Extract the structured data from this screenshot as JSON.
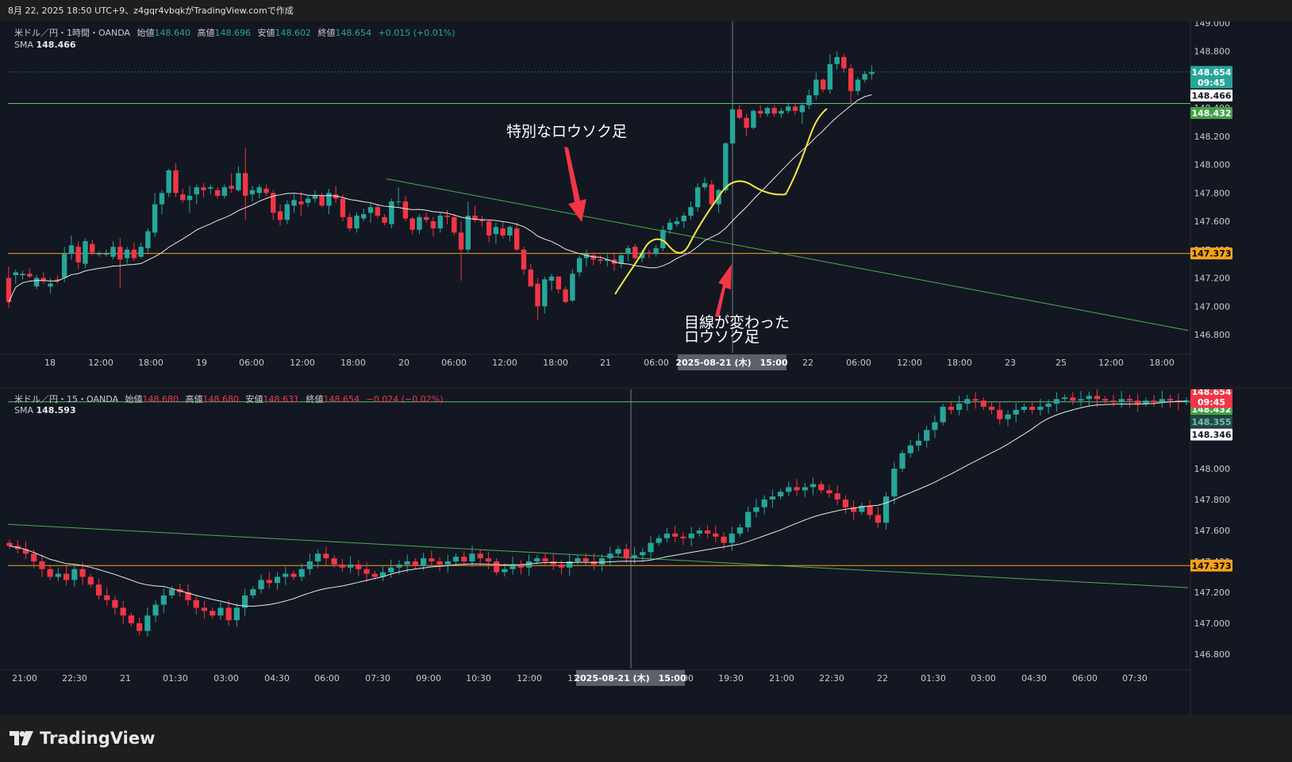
{
  "header": {
    "text": "8月 22, 2025 18:50 UTC+9、z4gqr4vbqkがTradingView.comで作成"
  },
  "brand": {
    "name": "TradingView"
  },
  "colors": {
    "background": "#131722",
    "up": "#26a69a",
    "down": "#f23645",
    "sma": "#e8e8e8",
    "level_orange": "#f7a21b",
    "level_green": "#66bb6a",
    "trendline": "#4caf50",
    "hand_drawn": "#f5e642",
    "arrow": "#f23645"
  },
  "chart1": {
    "legend": {
      "symbol": "米ドル／円・1時間・OANDA",
      "open_label": "始値",
      "open": "148.640",
      "high_label": "高値",
      "high": "148.696",
      "low_label": "安値",
      "low": "148.602",
      "close_label": "終値",
      "close": "148.654",
      "change": "+0.015 (+0.01%)",
      "sma_label": "SMA",
      "sma_value": "148.466"
    },
    "annotations": {
      "special_candle": "特別なロウソク足",
      "view_change_line1": "目線が変わった",
      "view_change_line2": "ロウソク足"
    },
    "crosshair_time": "2025-08-21 (木)　15:00",
    "badges": {
      "last_price": "148.654",
      "countdown": "09:45",
      "sma": "148.466",
      "green_level": "148.432",
      "orange_level": "147.373"
    }
  },
  "chart2": {
    "legend": {
      "symbol": "米ドル／円・15・OANDA",
      "open_label": "始値",
      "open": "148.680",
      "high_label": "高値",
      "high": "148.680",
      "low_label": "安値",
      "low": "148.631",
      "close_label": "終値",
      "close": "148.654",
      "change": "−0.024 (−0.02%)",
      "sma_label": "SMA",
      "sma_value": "148.593"
    },
    "crosshair_time": "2025-08-21 (木)　15:00",
    "badges": {
      "last_price": "148.654",
      "countdown": "09:45",
      "green_level": "148.432",
      "faded_level": "148.355",
      "sma": "148.346",
      "orange_level": "147.373"
    }
  },
  "chart_data": [
    {
      "type": "candlestick",
      "title": "米ドル／円・1時間・OANDA",
      "y_ticks": [
        "149.000",
        "148.800",
        "148.600",
        "148.400",
        "148.200",
        "148.000",
        "147.800",
        "147.600",
        "147.400",
        "147.200",
        "147.000",
        "146.800"
      ],
      "ylim": [
        146.72,
        149.02
      ],
      "x_ticks": [
        "18",
        "12:00",
        "18:00",
        "19",
        "06:00",
        "12:00",
        "18:00",
        "20",
        "06:00",
        "12:00",
        "18:00",
        "21",
        "06:00",
        "12:00",
        "18:00",
        "22",
        "06:00",
        "12:00",
        "18:00",
        "23",
        "25",
        "12:00",
        "18:00"
      ],
      "levels": {
        "orange": 147.373,
        "green": 148.432
      },
      "trendline": {
        "from": [
          147.9,
          "20 start"
        ],
        "to": [
          146.83,
          "right edge"
        ]
      },
      "candles_ohlc": [
        [
          147.2,
          147.28,
          146.99,
          147.03
        ],
        [
          147.22,
          147.26,
          147.16,
          147.24
        ],
        [
          147.22,
          147.25,
          147.19,
          147.23
        ],
        [
          147.23,
          147.27,
          147.2,
          147.21
        ],
        [
          147.14,
          147.22,
          147.12,
          147.2
        ],
        [
          147.2,
          147.24,
          147.16,
          147.18
        ],
        [
          147.14,
          147.2,
          147.09,
          147.16
        ],
        [
          147.19,
          147.22,
          147.16,
          147.18
        ],
        [
          147.2,
          147.42,
          147.17,
          147.37
        ],
        [
          147.37,
          147.5,
          147.33,
          147.43
        ],
        [
          147.42,
          147.46,
          147.26,
          147.31
        ],
        [
          147.3,
          147.48,
          147.27,
          147.46
        ],
        [
          147.44,
          147.47,
          147.36,
          147.38
        ],
        [
          147.37,
          147.39,
          147.35,
          147.37
        ],
        [
          147.37,
          147.4,
          147.35,
          147.37
        ],
        [
          147.35,
          147.46,
          147.33,
          147.42
        ],
        [
          147.42,
          147.48,
          147.13,
          147.33
        ],
        [
          147.34,
          147.42,
          147.3,
          147.4
        ],
        [
          147.4,
          147.45,
          147.32,
          147.34
        ],
        [
          147.35,
          147.45,
          147.34,
          147.42
        ],
        [
          147.41,
          147.55,
          147.38,
          147.53
        ],
        [
          147.52,
          147.8,
          147.49,
          147.72
        ],
        [
          147.72,
          147.82,
          147.65,
          147.8
        ],
        [
          147.8,
          147.97,
          147.77,
          147.96
        ],
        [
          147.96,
          148.01,
          147.77,
          147.8
        ],
        [
          147.79,
          147.83,
          147.73,
          147.75
        ],
        [
          147.75,
          147.85,
          147.66,
          147.78
        ],
        [
          147.79,
          147.86,
          147.72,
          147.84
        ],
        [
          147.84,
          147.87,
          147.77,
          147.82
        ],
        [
          147.83,
          147.86,
          147.79,
          147.84
        ],
        [
          147.82,
          147.84,
          147.76,
          147.78
        ],
        [
          147.78,
          147.86,
          147.76,
          147.84
        ],
        [
          147.85,
          147.94,
          147.8,
          147.83
        ],
        [
          147.82,
          147.99,
          147.81,
          147.94
        ],
        [
          147.94,
          148.12,
          147.61,
          147.78
        ],
        [
          147.79,
          147.85,
          147.74,
          147.82
        ],
        [
          147.8,
          147.86,
          147.76,
          147.84
        ],
        [
          147.83,
          147.86,
          147.78,
          147.8
        ],
        [
          147.8,
          147.82,
          147.61,
          147.66
        ],
        [
          147.67,
          147.72,
          147.57,
          147.61
        ],
        [
          147.61,
          147.75,
          147.58,
          147.72
        ],
        [
          147.71,
          147.79,
          147.66,
          147.75
        ],
        [
          147.74,
          147.81,
          147.64,
          147.72
        ],
        [
          147.73,
          147.78,
          147.7,
          147.76
        ],
        [
          147.76,
          147.82,
          147.73,
          147.78
        ],
        [
          147.78,
          147.8,
          147.7,
          147.71
        ],
        [
          147.71,
          147.83,
          147.65,
          147.8
        ],
        [
          147.79,
          147.85,
          147.73,
          147.76
        ],
        [
          147.76,
          147.79,
          147.6,
          147.63
        ],
        [
          147.63,
          147.66,
          147.53,
          147.55
        ],
        [
          147.55,
          147.66,
          147.52,
          147.64
        ],
        [
          147.62,
          147.69,
          147.6,
          147.65
        ],
        [
          147.66,
          147.73,
          147.59,
          147.7
        ],
        [
          147.7,
          147.72,
          147.62,
          147.64
        ],
        [
          147.63,
          147.65,
          147.57,
          147.59
        ],
        [
          147.58,
          147.76,
          147.55,
          147.74
        ],
        [
          147.74,
          147.84,
          147.71,
          147.74
        ],
        [
          147.74,
          147.78,
          147.6,
          147.62
        ],
        [
          147.62,
          147.63,
          147.51,
          147.54
        ],
        [
          147.54,
          147.65,
          147.51,
          147.63
        ],
        [
          147.63,
          147.66,
          147.59,
          147.61
        ],
        [
          147.6,
          147.63,
          147.49,
          147.55
        ],
        [
          147.55,
          147.66,
          147.52,
          147.64
        ],
        [
          147.64,
          147.68,
          147.58,
          147.63
        ],
        [
          147.63,
          147.65,
          147.5,
          147.52
        ],
        [
          147.52,
          147.6,
          147.18,
          147.4
        ],
        [
          147.4,
          147.74,
          147.37,
          147.64
        ],
        [
          147.64,
          147.71,
          147.59,
          147.61
        ],
        [
          147.61,
          147.64,
          147.56,
          147.6
        ],
        [
          147.6,
          147.61,
          147.45,
          147.5
        ],
        [
          147.51,
          147.59,
          147.44,
          147.56
        ],
        [
          147.55,
          147.6,
          147.48,
          147.5
        ],
        [
          147.5,
          147.57,
          147.46,
          147.56
        ],
        [
          147.55,
          147.59,
          147.39,
          147.4
        ],
        [
          147.4,
          147.42,
          147.22,
          147.26
        ],
        [
          147.26,
          147.3,
          147.14,
          147.14
        ],
        [
          147.16,
          147.2,
          146.9,
          147.0
        ],
        [
          147.0,
          147.21,
          146.95,
          147.19
        ],
        [
          147.18,
          147.23,
          147.11,
          147.21
        ],
        [
          147.21,
          147.21,
          147.09,
          147.12
        ],
        [
          147.12,
          147.14,
          147.02,
          147.03
        ],
        [
          147.04,
          147.26,
          147.03,
          147.23
        ],
        [
          147.24,
          147.36,
          147.21,
          147.34
        ],
        [
          147.34,
          147.4,
          147.28,
          147.37
        ],
        [
          147.36,
          147.38,
          147.29,
          147.33
        ],
        [
          147.33,
          147.36,
          147.3,
          147.32
        ],
        [
          147.32,
          147.38,
          147.28,
          147.33
        ],
        [
          147.33,
          147.37,
          147.25,
          147.3
        ],
        [
          147.3,
          147.38,
          147.27,
          147.36
        ],
        [
          147.37,
          147.43,
          147.32,
          147.41
        ],
        [
          147.42,
          147.44,
          147.33,
          147.34
        ],
        [
          147.34,
          147.4,
          147.31,
          147.38
        ],
        [
          147.38,
          147.4,
          147.34,
          147.37
        ],
        [
          147.37,
          147.43,
          147.35,
          147.41
        ],
        [
          147.41,
          147.57,
          147.39,
          147.54
        ],
        [
          147.54,
          147.62,
          147.51,
          147.59
        ],
        [
          147.58,
          147.63,
          147.56,
          147.6
        ],
        [
          147.6,
          147.66,
          147.55,
          147.64
        ],
        [
          147.64,
          147.74,
          147.61,
          147.7
        ],
        [
          147.7,
          147.87,
          147.67,
          147.84
        ],
        [
          147.84,
          147.91,
          147.82,
          147.87
        ],
        [
          147.86,
          147.89,
          147.71,
          147.72
        ],
        [
          147.72,
          147.83,
          147.66,
          147.82
        ],
        [
          147.82,
          148.16,
          147.8,
          148.15
        ],
        [
          148.15,
          148.45,
          148.12,
          148.39
        ],
        [
          148.39,
          148.42,
          148.32,
          148.33
        ],
        [
          148.33,
          148.36,
          148.2,
          148.26
        ],
        [
          148.26,
          148.39,
          148.25,
          148.38
        ],
        [
          148.38,
          148.42,
          148.33,
          148.36
        ],
        [
          148.36,
          148.41,
          148.34,
          148.4
        ],
        [
          148.4,
          148.42,
          148.34,
          148.36
        ],
        [
          148.36,
          148.4,
          148.33,
          148.38
        ],
        [
          148.38,
          148.44,
          148.36,
          148.41
        ],
        [
          148.41,
          148.43,
          148.35,
          148.38
        ],
        [
          148.37,
          148.44,
          148.29,
          148.42
        ],
        [
          148.42,
          148.53,
          148.39,
          148.49
        ],
        [
          148.49,
          148.65,
          148.46,
          148.6
        ],
        [
          148.6,
          148.61,
          148.51,
          148.53
        ],
        [
          148.53,
          148.78,
          148.5,
          148.71
        ],
        [
          148.71,
          148.8,
          148.67,
          148.76
        ],
        [
          148.76,
          148.78,
          148.65,
          148.68
        ],
        [
          148.68,
          148.71,
          148.43,
          148.52
        ],
        [
          148.52,
          148.62,
          148.49,
          148.6
        ],
        [
          148.6,
          148.66,
          148.58,
          148.64
        ],
        [
          148.64,
          148.7,
          148.6,
          148.654
        ]
      ]
    },
    {
      "type": "candlestick",
      "title": "米ドル／円・15・OANDA",
      "y_ticks": [
        "148.000",
        "147.800",
        "147.600",
        "147.400",
        "147.200",
        "147.000",
        "146.800"
      ],
      "ylim": [
        146.72,
        148.6
      ],
      "x_ticks": [
        "21:00",
        "22:30",
        "21",
        "01:30",
        "03:00",
        "04:30",
        "06:00",
        "07:30",
        "09:00",
        "10:30",
        "12:00",
        "13:30",
        "15:00",
        "18:00",
        "19:30",
        "21:00",
        "22:30",
        "22",
        "01:30",
        "03:00",
        "04:30",
        "06:00",
        "07:30"
      ],
      "levels": {
        "orange": 147.373,
        "green": 148.432
      }
    }
  ]
}
